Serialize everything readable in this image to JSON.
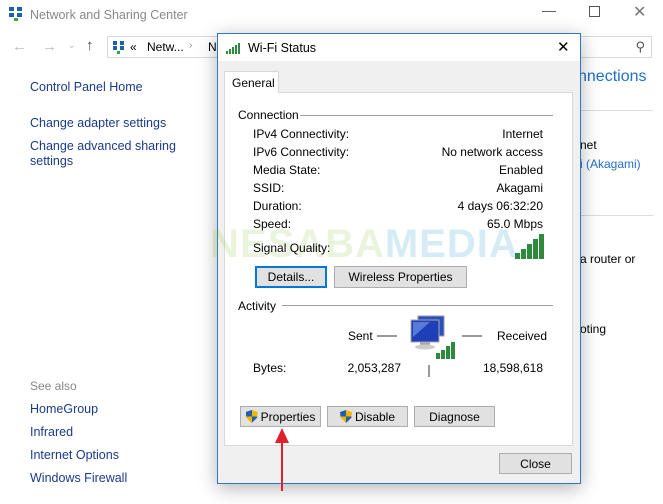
{
  "window": {
    "title": "Network and Sharing Center",
    "address": {
      "overflow": "«",
      "segment1": "Netw...",
      "segment2": "N"
    }
  },
  "sidebar": {
    "home": "Control Panel Home",
    "links": [
      "Change adapter settings",
      "Change advanced sharing settings"
    ],
    "see_also_title": "See also",
    "see_also": [
      "HomeGroup",
      "Infrared",
      "Internet Options",
      "Windows Firewall"
    ]
  },
  "background_main": {
    "heading": "nnections",
    "access_label": "net",
    "connection_link": "i (Akagami)",
    "router_text": "a router or",
    "troubleshoot_text": "oting"
  },
  "dialog": {
    "title": "Wi-Fi Status",
    "tab": "General",
    "connection_heading": "Connection",
    "rows": [
      {
        "label": "IPv4 Connectivity:",
        "value": "Internet"
      },
      {
        "label": "IPv6 Connectivity:",
        "value": "No network access"
      },
      {
        "label": "Media State:",
        "value": "Enabled"
      },
      {
        "label": "SSID:",
        "value": "Akagami"
      },
      {
        "label": "Duration:",
        "value": "4 days 06:32:20"
      },
      {
        "label": "Speed:",
        "value": "65.0 Mbps"
      }
    ],
    "signal_label": "Signal Quality:",
    "signal_bars": 5,
    "details_button": "Details...",
    "wireless_button": "Wireless Properties",
    "activity_heading": "Activity",
    "sent_label": "Sent",
    "received_label": "Received",
    "bytes_label": "Bytes:",
    "bytes_sent": "2,053,287",
    "bytes_received": "18,598,618",
    "properties_button": "Properties",
    "disable_button": "Disable",
    "diagnose_button": "Diagnose",
    "close_button": "Close"
  },
  "watermark": "NESABAMEDIA",
  "colors": {
    "accent": "#1e6fc8",
    "signal": "#2e8b3e",
    "arrow": "#e0202a"
  }
}
